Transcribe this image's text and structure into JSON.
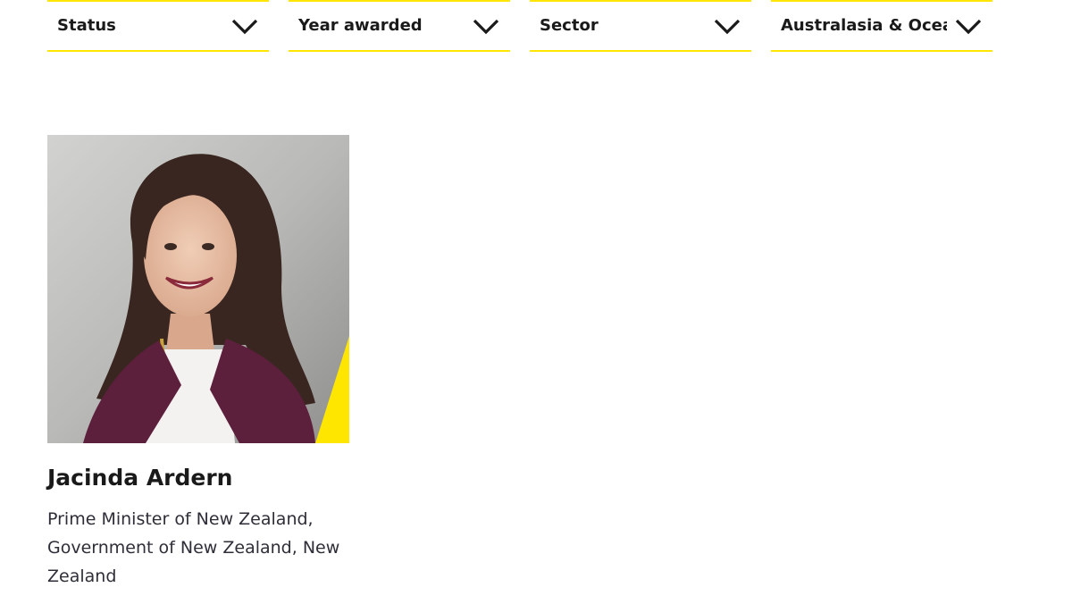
{
  "filters": [
    {
      "label": "Status",
      "icon": "chevron-down-icon"
    },
    {
      "label": "Year awarded",
      "icon": "chevron-down-icon"
    },
    {
      "label": "Sector",
      "icon": "chevron-down-icon"
    },
    {
      "label": "Australasia & Oceania",
      "icon": "chevron-down-icon"
    }
  ],
  "colors": {
    "accent": "#ffe600",
    "text": "#1a1a1a",
    "subtext": "#2e2e38",
    "blazer": "#5c1f3c"
  },
  "card": {
    "name": "Jacinda Ardern",
    "role": "Prime Minister of New Zealand, Government of New Zealand, New Zealand"
  }
}
